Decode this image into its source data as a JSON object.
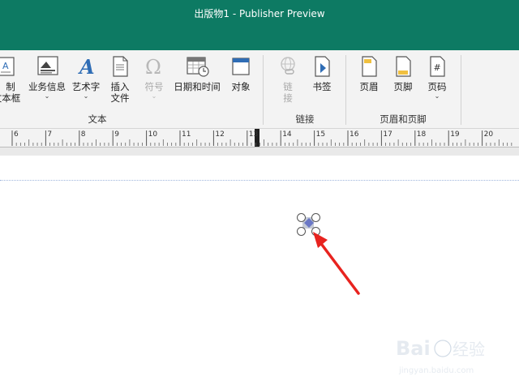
{
  "window": {
    "title": "出版物1  -  Publisher Preview"
  },
  "ribbon": {
    "text_group": {
      "label": "文本",
      "draw_textbox": {
        "line1": "制",
        "line2": "文本框"
      },
      "business_info": {
        "label": "业务信息"
      },
      "wordart": {
        "label": "艺术字"
      },
      "insert_file": {
        "line1": "插入",
        "line2": "文件"
      },
      "symbol": {
        "label": "符号"
      },
      "datetime": {
        "label": "日期和时间"
      },
      "object": {
        "label": "对象"
      }
    },
    "links_group": {
      "label": "链接",
      "link": {
        "line1": "链",
        "line2": "接"
      },
      "bookmark": {
        "label": "书签"
      }
    },
    "header_footer_group": {
      "label": "页眉和页脚",
      "header": {
        "label": "页眉"
      },
      "footer": {
        "label": "页脚"
      },
      "page_number": {
        "label": "页码"
      }
    },
    "icons": {
      "draw_textbox": "textbox-icon",
      "business_info": "business-info-icon",
      "wordart": "wordart-icon",
      "insert_file": "file-icon",
      "symbol": "omega-icon",
      "datetime": "calendar-clock-icon",
      "object": "object-icon",
      "link": "link-icon",
      "bookmark": "bookmark-icon",
      "header": "header-icon",
      "footer": "footer-icon",
      "page_number": "page-number-icon"
    }
  },
  "ruler": {
    "numbers": [
      "6",
      "7",
      "8",
      "9",
      "10",
      "11",
      "12",
      "13",
      "14",
      "15",
      "16",
      "17",
      "18",
      "19",
      "20"
    ]
  },
  "watermark": {
    "brand": "Baidu经验",
    "url": "jingyan.baidu.com"
  },
  "colors": {
    "title_bar": "#0d7a63",
    "ribbon_bg": "#f3f3f3",
    "accent_blue": "#2f6db5",
    "arrow": "#e8231f"
  }
}
